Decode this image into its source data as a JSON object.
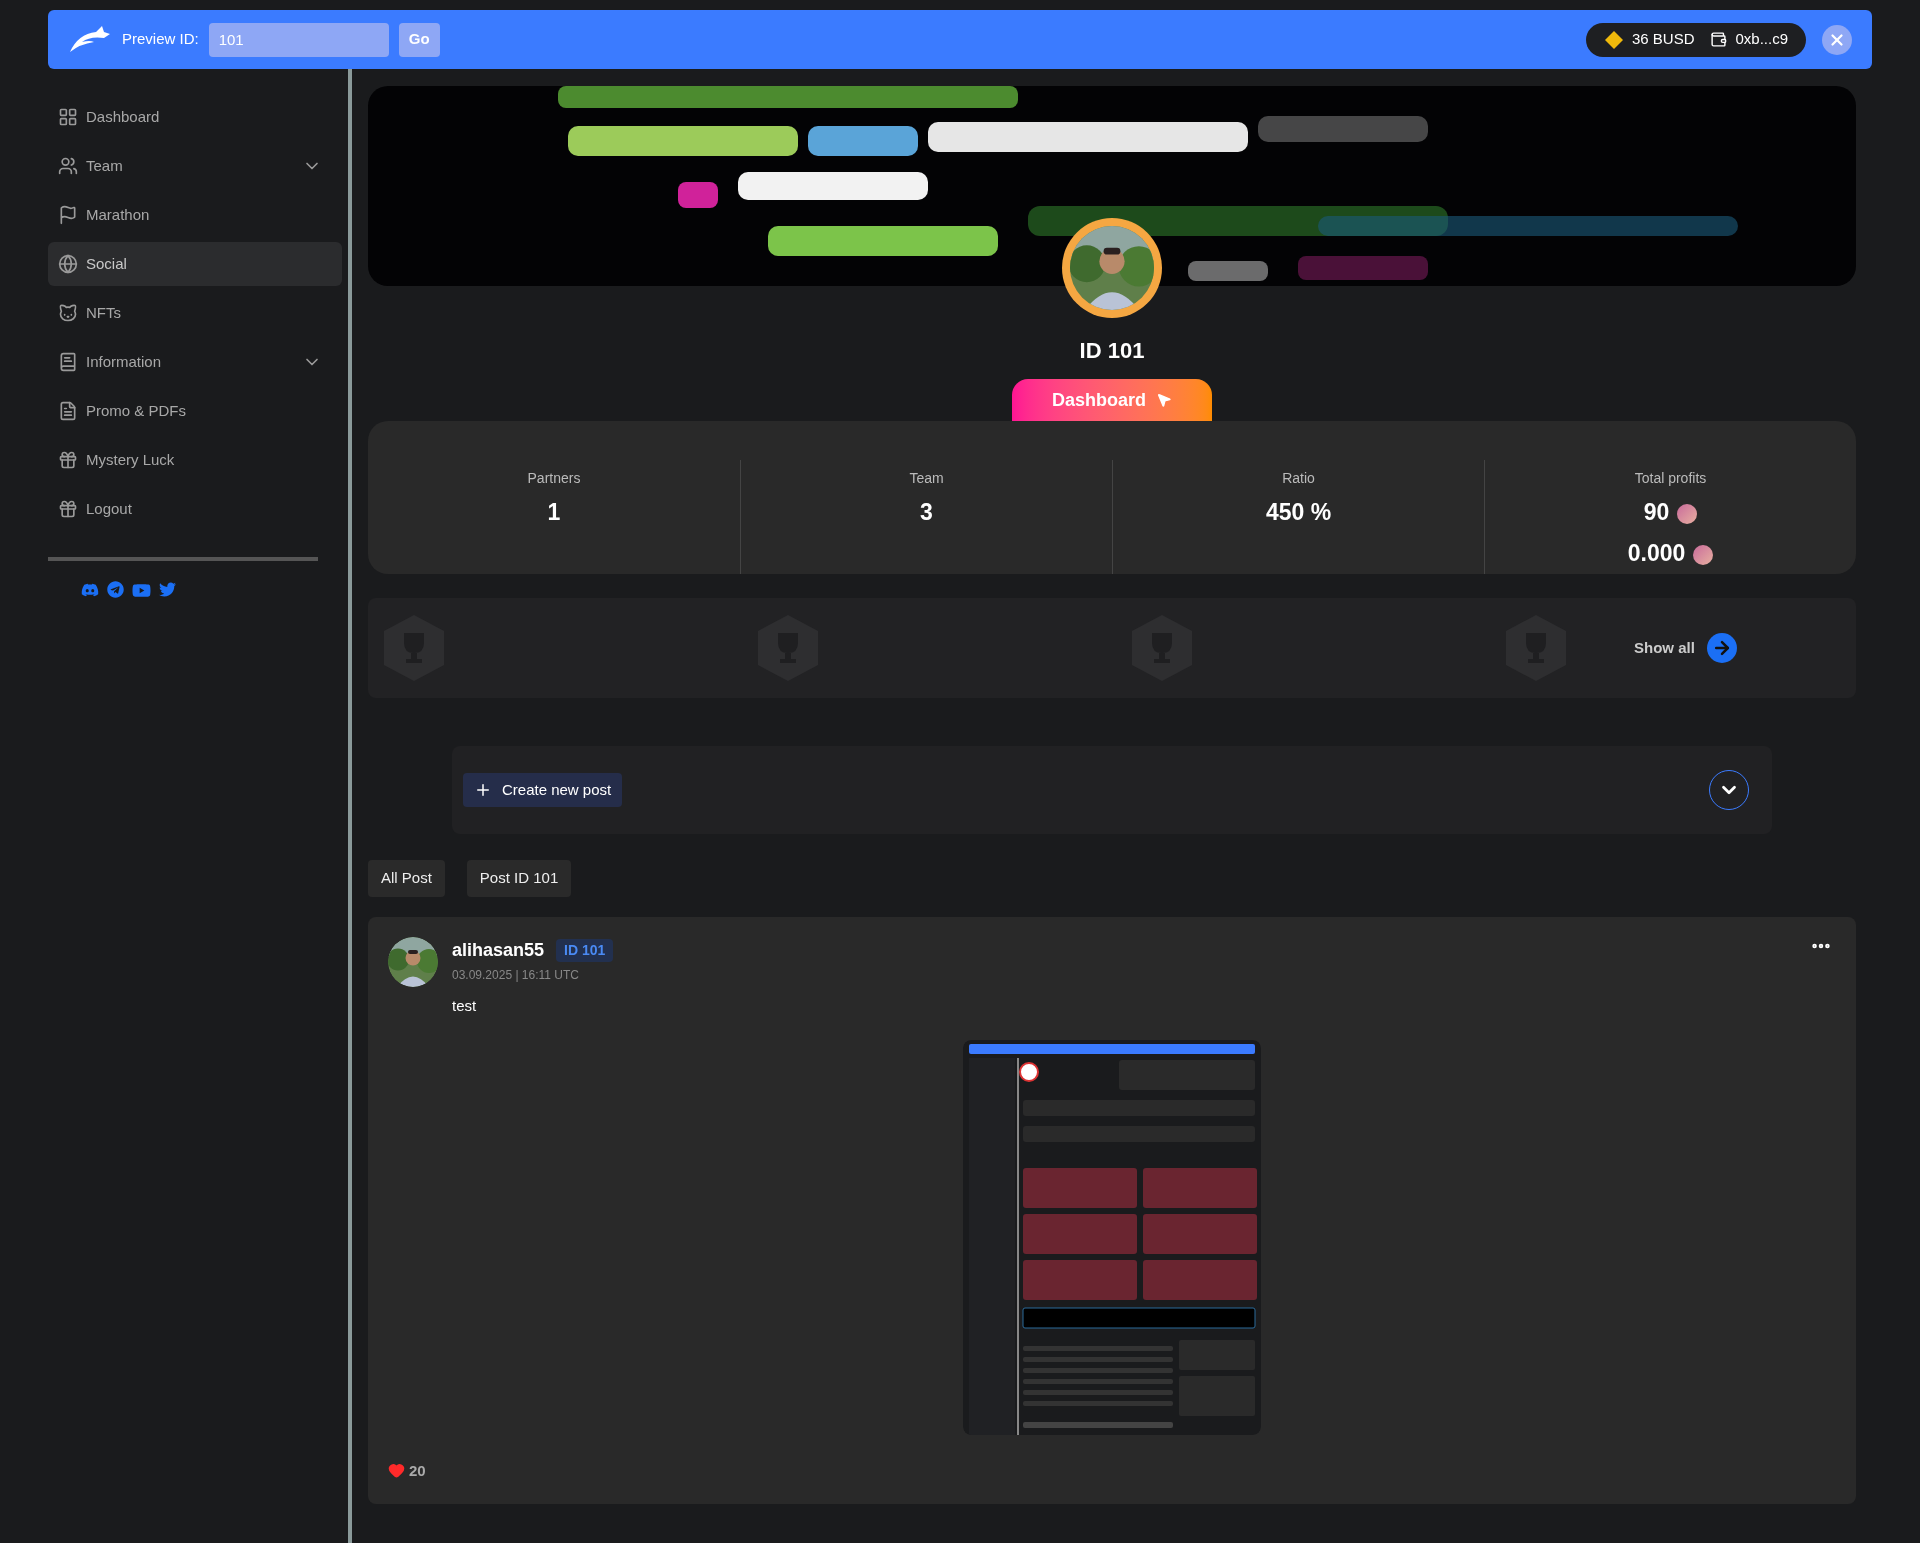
{
  "topbar": {
    "label": "Preview ID:",
    "id_value": "101",
    "go_button": "Go",
    "balance": "36 BUSD",
    "wallet": "0xb...c9"
  },
  "sidebar": {
    "items": [
      {
        "label": "Dashboard",
        "selected": false,
        "has_submenu": false
      },
      {
        "label": "Team",
        "selected": false,
        "has_submenu": true
      },
      {
        "label": "Marathon",
        "selected": false,
        "has_submenu": false
      },
      {
        "label": "Social",
        "selected": true,
        "has_submenu": false
      },
      {
        "label": "NFTs",
        "selected": false,
        "has_submenu": false
      },
      {
        "label": "Information",
        "selected": false,
        "has_submenu": true
      },
      {
        "label": "Promo & PDFs",
        "selected": false,
        "has_submenu": false
      },
      {
        "label": "Mystery Luck",
        "selected": false,
        "has_submenu": false
      },
      {
        "label": "Logout",
        "selected": false,
        "has_submenu": false
      }
    ]
  },
  "profile": {
    "id_label": "ID 101",
    "button": "Dashboard"
  },
  "stats": [
    {
      "label": "Partners",
      "kind": "plain",
      "values": [
        "1"
      ]
    },
    {
      "label": "Team",
      "kind": "plain",
      "values": [
        "3"
      ]
    },
    {
      "label": "Ratio",
      "kind": "plain",
      "values": [
        "450 %"
      ]
    },
    {
      "label": "Total profits",
      "kind": "coin",
      "values": [
        "90",
        "0.000"
      ]
    }
  ],
  "achievements": {
    "show_all": "Show all"
  },
  "composer": {
    "create_button": "Create new post"
  },
  "filter_tabs": [
    {
      "label": "All Post",
      "selected": false
    },
    {
      "label": "Post ID 101",
      "selected": false
    }
  ],
  "post": {
    "author": "alihasan55",
    "badge": "ID 101",
    "timestamp": "03.09.2025 | 16:11 UTC",
    "text": "test",
    "likes": "20",
    "liked": true
  }
}
